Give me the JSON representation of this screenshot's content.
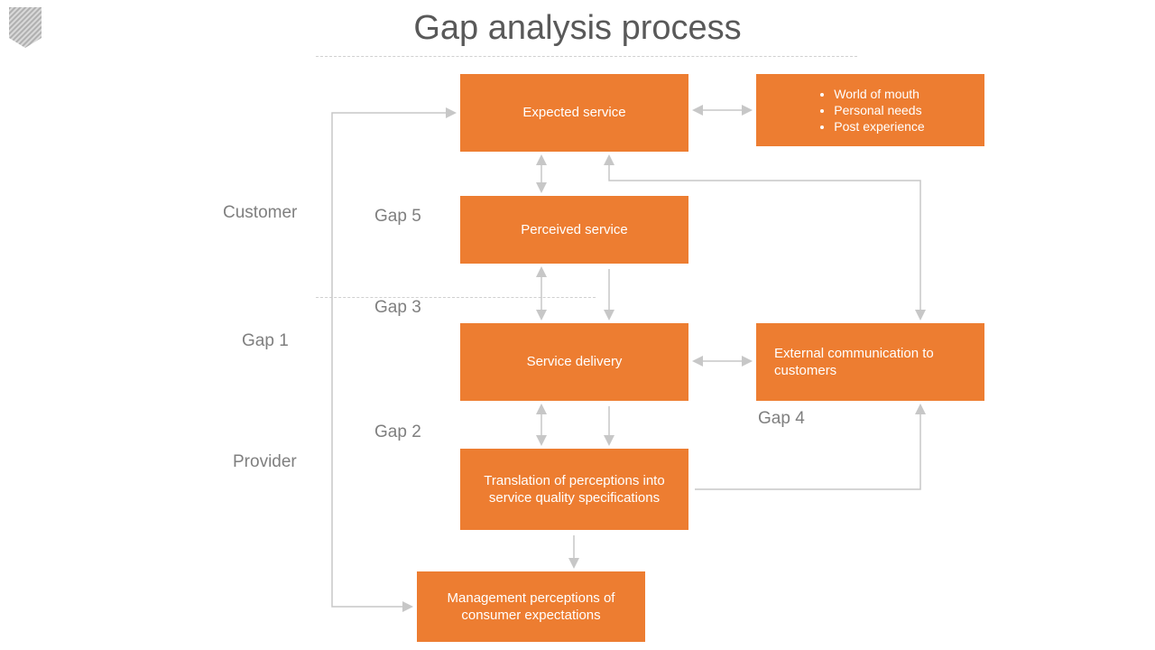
{
  "title": "Gap analysis process",
  "labels": {
    "customer": "Customer",
    "provider": "Provider",
    "gap1": "Gap 1",
    "gap2": "Gap 2",
    "gap3": "Gap 3",
    "gap4": "Gap 4",
    "gap5": "Gap 5"
  },
  "boxes": {
    "expected": "Expected service",
    "perceived": "Perceived service",
    "delivery": "Service delivery",
    "translation": "Translation of perceptions into service quality specifications",
    "management": "Management perceptions of consumer expectations",
    "external": "External communication to customers",
    "bullets": {
      "b1": "World of mouth",
      "b2": "Personal needs",
      "b3": "Post experience"
    }
  }
}
